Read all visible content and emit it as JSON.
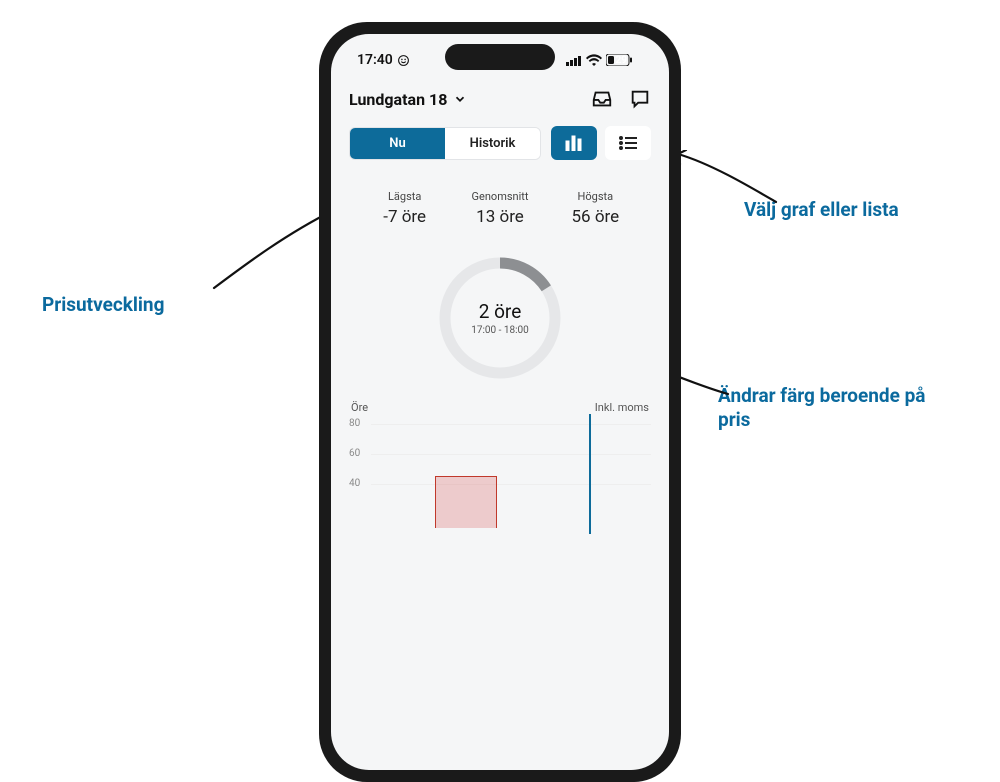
{
  "status": {
    "time": "17:40",
    "battery": "29"
  },
  "header": {
    "location": "Lundgatan 18"
  },
  "tabs": {
    "now": "Nu",
    "history": "Historik"
  },
  "stats": {
    "low_label": "Lägsta",
    "low_value": "-7 öre",
    "avg_label": "Genomsnitt",
    "avg_value": "13 öre",
    "high_label": "Högsta",
    "high_value": "56 öre"
  },
  "gauge": {
    "price": "2 öre",
    "interval": "17:00 - 18:00"
  },
  "chart": {
    "y_label": "Öre",
    "vat_label": "Inkl. moms",
    "ticks": {
      "t80": "80",
      "t60": "60",
      "t40": "40"
    }
  },
  "annotations": {
    "price_dev": "Prisutveckling",
    "choose_view": "Välj graf eller lista",
    "color_changes": "Ändrar färg beroende på pris"
  },
  "chart_data": {
    "type": "bar",
    "title": "",
    "xlabel": "",
    "ylabel": "Öre",
    "ylim": [
      0,
      80
    ],
    "note": "Inkl. moms",
    "categories_hint": "hourly slots — only partial chart visible in screenshot",
    "visible_series": [
      {
        "name": "price-bars-red-region",
        "approx_values": [
          40,
          42,
          40
        ]
      },
      {
        "name": "vertical-marker-line",
        "color": "#0d6b9a"
      }
    ]
  }
}
